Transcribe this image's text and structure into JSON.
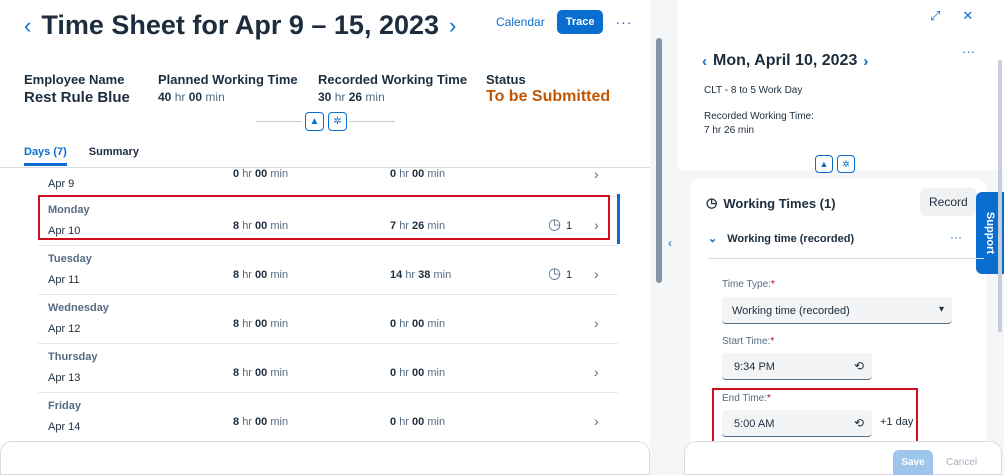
{
  "header": {
    "title": "Time Sheet for Apr 9 – 15, 2023",
    "prev": "‹",
    "next": "›",
    "calendar": "Calendar",
    "trace": "Trace",
    "more": "···"
  },
  "attrs": {
    "employee_label": "Employee Name",
    "employee_value": "Rest Rule Blue",
    "planned_label": "Planned Working Time",
    "planned_h": "40",
    "planned_m": "00",
    "recorded_label": "Recorded Working Time",
    "recorded_h": "30",
    "recorded_m": "26",
    "status_label": "Status",
    "status_value": "To be Submitted"
  },
  "units": {
    "hr": "hr",
    "min": "min"
  },
  "tabs": [
    {
      "label": "Days (7)"
    },
    {
      "label": "Summary"
    }
  ],
  "rows": [
    {
      "day": "",
      "date": "Apr 9",
      "p_h": "0",
      "p_m": "00",
      "r_h": "0",
      "r_m": "00",
      "count": ""
    },
    {
      "day": "Monday",
      "date": "Apr 10",
      "p_h": "8",
      "p_m": "00",
      "r_h": "7",
      "r_m": "26",
      "count": "1"
    },
    {
      "day": "Tuesday",
      "date": "Apr 11",
      "p_h": "8",
      "p_m": "00",
      "r_h": "14",
      "r_m": "38",
      "count": "1"
    },
    {
      "day": "Wednesday",
      "date": "Apr 12",
      "p_h": "8",
      "p_m": "00",
      "r_h": "0",
      "r_m": "00",
      "count": ""
    },
    {
      "day": "Thursday",
      "date": "Apr 13",
      "p_h": "8",
      "p_m": "00",
      "r_h": "0",
      "r_m": "00",
      "count": ""
    },
    {
      "day": "Friday",
      "date": "Apr 14",
      "p_h": "8",
      "p_m": "00",
      "r_h": "0",
      "r_m": "00",
      "count": ""
    }
  ],
  "detail": {
    "day_title": "Mon, April 10, 2023",
    "schedule": "CLT - 8 to 5 Work Day",
    "recorded_label": "Recorded Working Time:",
    "recorded_value": "7 hr 26 min",
    "section_title": "Working Times (1)",
    "record_btn": "Record",
    "support": "Support",
    "entry_title": "Working time (recorded)",
    "time_type_label": "Time Type:",
    "time_type_value": "Working time (recorded)",
    "start_label": "Start Time:",
    "start_value": "9:34 PM",
    "end_label": "End Time:",
    "end_value": "5:00 AM",
    "plus_day": "+1 day",
    "required": "*",
    "save": "Save",
    "cancel": "Cancel"
  },
  "colors": {
    "accent": "#0a6ed1",
    "status": "#c35500",
    "highlight": "#d0101c"
  }
}
